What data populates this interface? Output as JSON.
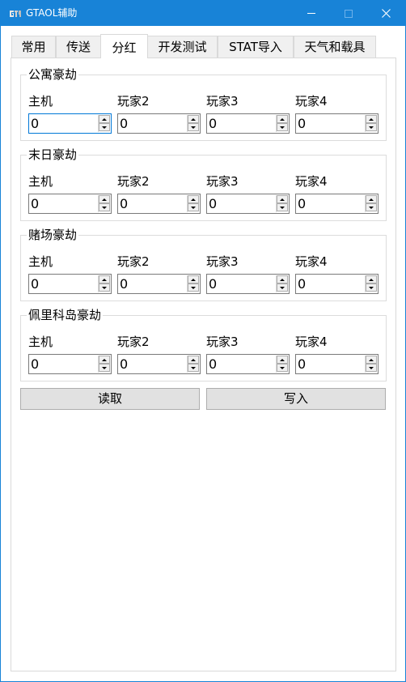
{
  "window": {
    "title": "GTAOL辅助",
    "app_icon": "gta-logo-icon",
    "controls": [
      "minimize-icon",
      "maximize-icon",
      "close-icon"
    ]
  },
  "tabs": [
    {
      "label": "常用",
      "active": false
    },
    {
      "label": "传送",
      "active": false
    },
    {
      "label": "分红",
      "active": true
    },
    {
      "label": "开发测试",
      "active": false
    },
    {
      "label": "STAT导入",
      "active": false
    },
    {
      "label": "天气和载具",
      "active": false
    }
  ],
  "groups": [
    {
      "title": "公寓豪劫",
      "fields": [
        {
          "label": "主机",
          "value": "0"
        },
        {
          "label": "玩家2",
          "value": "0"
        },
        {
          "label": "玩家3",
          "value": "0"
        },
        {
          "label": "玩家4",
          "value": "0"
        }
      ]
    },
    {
      "title": "末日豪劫",
      "fields": [
        {
          "label": "主机",
          "value": "0"
        },
        {
          "label": "玩家2",
          "value": "0"
        },
        {
          "label": "玩家3",
          "value": "0"
        },
        {
          "label": "玩家4",
          "value": "0"
        }
      ]
    },
    {
      "title": "赌场豪劫",
      "fields": [
        {
          "label": "主机",
          "value": "0"
        },
        {
          "label": "玩家2",
          "value": "0"
        },
        {
          "label": "玩家3",
          "value": "0"
        },
        {
          "label": "玩家4",
          "value": "0"
        }
      ]
    },
    {
      "title": "佩里科岛豪劫",
      "fields": [
        {
          "label": "主机",
          "value": "0"
        },
        {
          "label": "玩家2",
          "value": "0"
        },
        {
          "label": "玩家3",
          "value": "0"
        },
        {
          "label": "玩家4",
          "value": "0"
        }
      ]
    }
  ],
  "actions": {
    "read_label": "读取",
    "write_label": "写入"
  },
  "colors": {
    "titlebar": "#1883d7",
    "focus_border": "#0078d7",
    "button_face": "#e1e1e1"
  }
}
